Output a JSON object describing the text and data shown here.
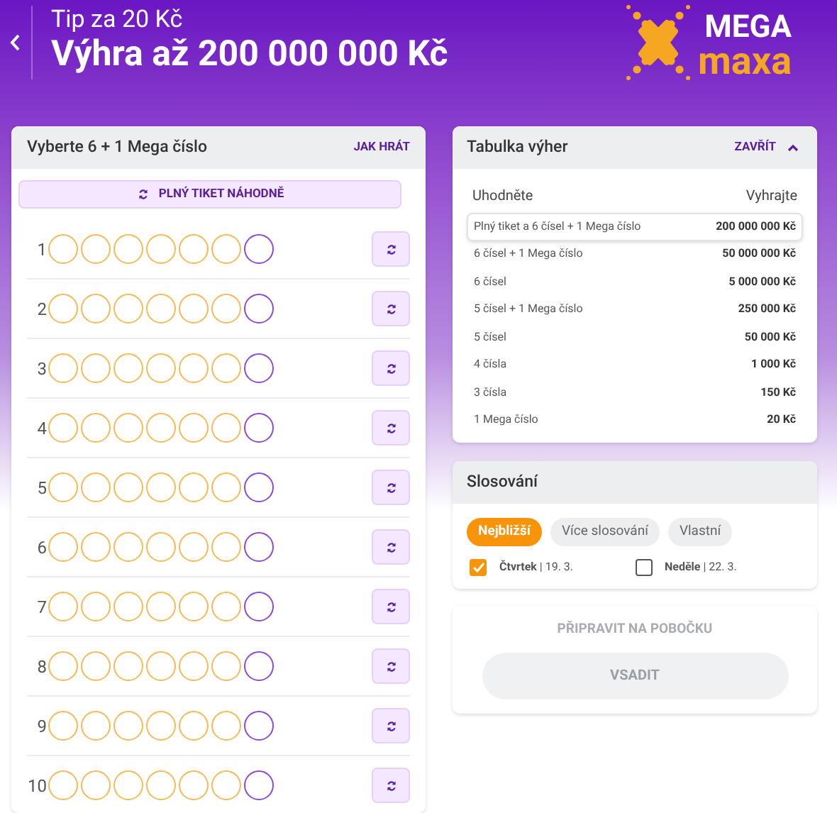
{
  "header": {
    "subtitle": "Tip za 20 Kč",
    "title": "Výhra až 200 000 000 Kč",
    "logo_top": "MEGA",
    "logo_bottom": "maxa"
  },
  "picker": {
    "title": "Vyberte 6 + 1 Mega číslo",
    "help_link": "JAK HRÁT",
    "random_button": "PLNÝ TIKET NÁHODNĚ",
    "tickets": [
      {
        "number": "1"
      },
      {
        "number": "2"
      },
      {
        "number": "3"
      },
      {
        "number": "4"
      },
      {
        "number": "5"
      },
      {
        "number": "6"
      },
      {
        "number": "7"
      },
      {
        "number": "8"
      },
      {
        "number": "9"
      },
      {
        "number": "10"
      }
    ]
  },
  "prize_table": {
    "title": "Tabulka výher",
    "toggle": "ZAVŘÍT",
    "expanded": true,
    "columns": [
      "Uhodněte",
      "Vyhrajte"
    ],
    "rows": [
      {
        "guess": "Plný tiket a 6 čísel + 1 Mega číslo",
        "prize": "200 000 000 Kč",
        "highlighted": true
      },
      {
        "guess": "6 čísel + 1 Mega číslo",
        "prize": "50 000 000 Kč",
        "highlighted": false
      },
      {
        "guess": "6 čísel",
        "prize": "5 000 000 Kč",
        "highlighted": false
      },
      {
        "guess": "5 čísel + 1 Mega číslo",
        "prize": "250 000 Kč",
        "highlighted": false
      },
      {
        "guess": "5 čísel",
        "prize": "50 000 Kč",
        "highlighted": false
      },
      {
        "guess": "4 čísla",
        "prize": "1 000 Kč",
        "highlighted": false
      },
      {
        "guess": "3 čísla",
        "prize": "150 Kč",
        "highlighted": false
      },
      {
        "guess": "1 Mega číslo",
        "prize": "20 Kč",
        "highlighted": false
      }
    ]
  },
  "draws": {
    "title": "Slosování",
    "tabs": [
      {
        "label": "Nejbližší",
        "selected": true
      },
      {
        "label": "Více slosování",
        "selected": false
      },
      {
        "label": "Vlastní",
        "selected": false
      }
    ],
    "dates": [
      {
        "label": "**Čtvrtek** | 19. 3.",
        "checked": true
      },
      {
        "label": "**Neděle** | 22. 3.",
        "checked": false
      }
    ]
  },
  "actions": {
    "branch_button": {
      "label": "PŘIPRAVIT NA POBOČKU",
      "disabled": true
    },
    "bet_button": {
      "label": "VSADIT",
      "disabled": true
    }
  }
}
